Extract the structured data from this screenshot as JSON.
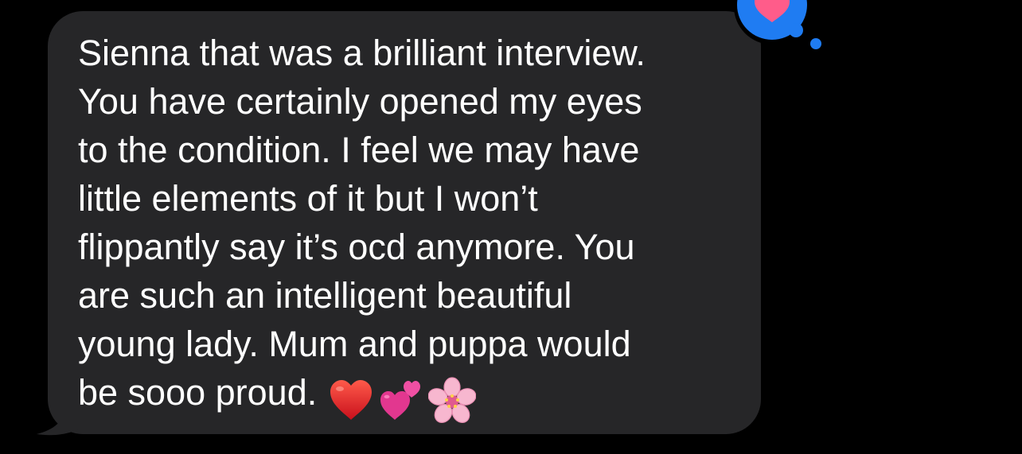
{
  "conversation": {
    "message": {
      "lines": [
        "Sienna that was a brilliant interview.",
        "You have certainly opened my eyes",
        "to the condition. I feel we may have",
        "little elements of it but I won’t",
        "flippantly say it’s ocd anymore. You",
        "are such an intelligent beautiful",
        "young lady. Mum and puppa would",
        "be sooo proud."
      ],
      "emojis": [
        "red-heart",
        "two-hearts",
        "cherry-blossom"
      ],
      "bubble_color": "#262628",
      "text_color": "#ffffff"
    },
    "tapback": {
      "reaction": "heart",
      "badge_color": "#1f7cf2",
      "heart_color": "#ff5c8a"
    },
    "background_color": "#000000"
  }
}
